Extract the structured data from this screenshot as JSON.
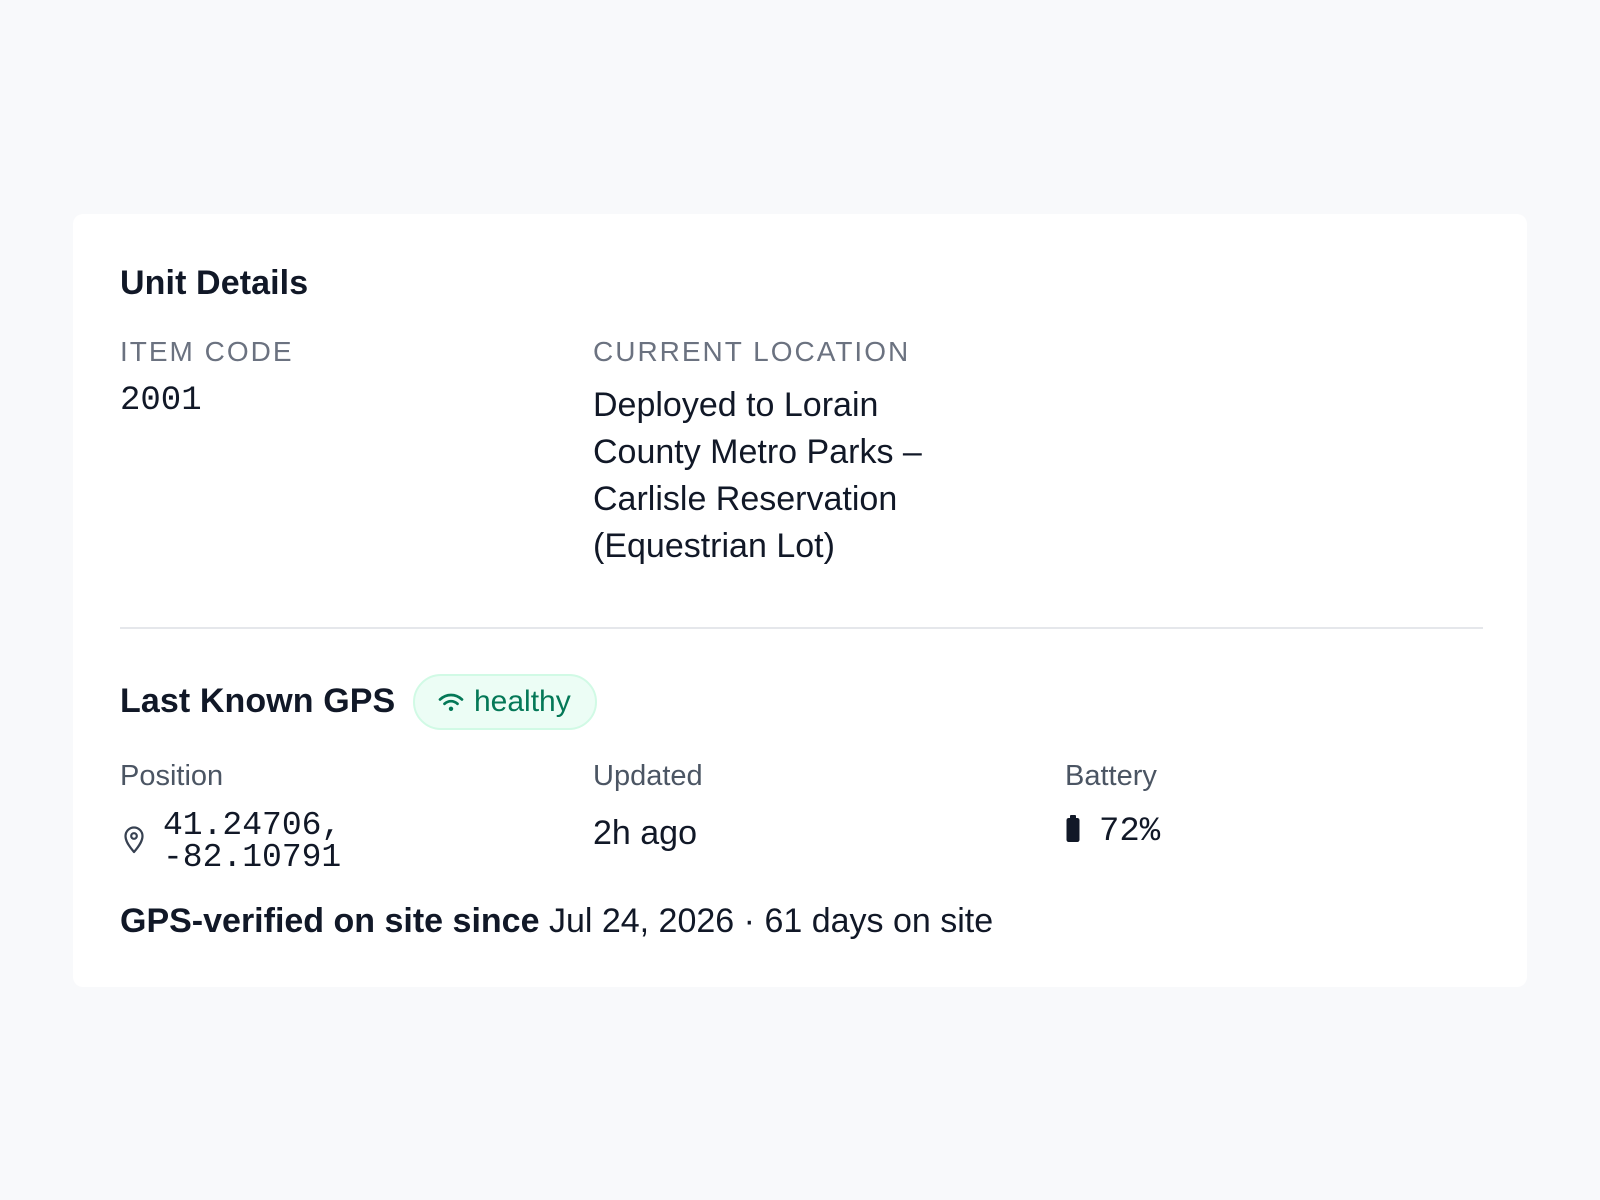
{
  "unit_details": {
    "title": "Unit Details",
    "item_code_label": "ITEM CODE",
    "item_code": "2001",
    "current_location_label": "CURRENT LOCATION",
    "current_location": "Deployed to Lorain County Metro Parks – Carlisle Reservation (Equestrian Lot)"
  },
  "gps": {
    "title": "Last Known GPS",
    "status_badge": "healthy",
    "status_icon": "wifi-icon",
    "position_label": "Position",
    "position_value": "41.24706, -82.10791",
    "position_icon": "map-pin-icon",
    "updated_label": "Updated",
    "updated_value": "2h ago",
    "battery_label": "Battery",
    "battery_value": "72%",
    "battery_icon": "battery-icon",
    "verification_prefix": "GPS-verified on site since",
    "verification_date": "Jul 24, 2026",
    "verification_separator": "·",
    "verification_days": "61 days on site"
  },
  "colors": {
    "page_background": "#f8f9fb",
    "card_background": "#ffffff",
    "healthy_accent": "#047857",
    "healthy_background": "#ecfdf5"
  }
}
